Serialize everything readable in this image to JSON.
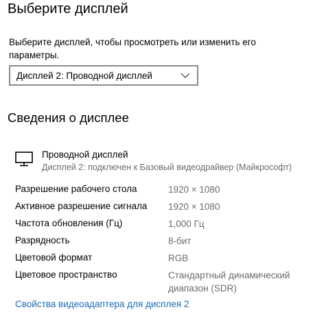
{
  "header": {
    "title": "Выберите дисплей",
    "description": "Выберите дисплей, чтобы просмотреть или изменить его параметры."
  },
  "display_select": {
    "selected": "Дисплей 2: Проводной дисплей"
  },
  "info": {
    "title": "Сведения о дисплее",
    "monitor_icon": "monitor-icon",
    "monitor_name": "Проводной дисплей",
    "monitor_subtitle": "Дисплей 2: подключен к Базовый видеодрайвер (Майкрософт)",
    "properties": [
      {
        "label": "Разрешение рабочего стола",
        "value": "1920 × 1080"
      },
      {
        "label": "Активное разрешение сигнала",
        "value": "1920 × 1080"
      },
      {
        "label": "Частота обновления (Гц)",
        "value": "1,000 Гц"
      },
      {
        "label": "Разрядность",
        "value": "8-бит"
      },
      {
        "label": "Цветовой формат",
        "value": "RGB"
      },
      {
        "label": "Цветовое пространство",
        "value": "Стандартный динамический диапазон (SDR)"
      }
    ],
    "adapter_link": "Свойства видеоадаптера для дисплея 2"
  },
  "colors": {
    "link": "#1a6bb8",
    "secondary_text": "#6b6b6b",
    "border": "#8a8a8a"
  }
}
